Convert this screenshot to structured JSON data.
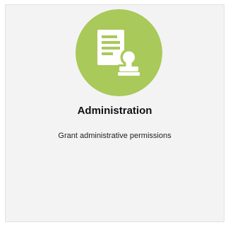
{
  "card": {
    "title": "Administration",
    "description": "Grant administrative permissions",
    "icon": "document-stamp-icon",
    "colors": {
      "icon_background": "#a9c95a",
      "icon_foreground": "#ffffff",
      "card_background": "#f3f3f3",
      "card_border": "#e2e2e2"
    }
  }
}
